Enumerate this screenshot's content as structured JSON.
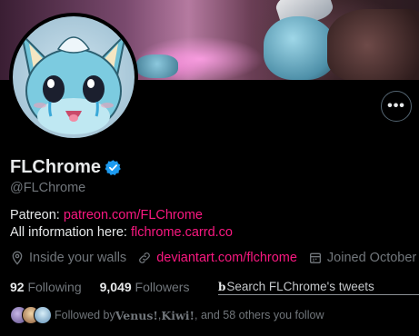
{
  "profile": {
    "display_name": "FLChrome",
    "handle": "@FLChrome",
    "verified_color": "#1d9bf0",
    "more_label": "•••"
  },
  "bio": {
    "line1_prefix": "Patreon: ",
    "line1_link": "patreon.com/FLChrome",
    "line2_prefix": "All information here: ",
    "line2_link": "flchrome.carrd.co"
  },
  "meta": {
    "location": "Inside your walls",
    "website": "deviantart.com/flchrome",
    "joined": "Joined October"
  },
  "stats": {
    "following_count": "92",
    "following_label": "Following",
    "followers_count": "9,049",
    "followers_label": "Followers"
  },
  "search": {
    "prefix": "b",
    "placeholder": "Search FLChrome's tweets"
  },
  "followed_by": {
    "prefix": "Followed by ",
    "name1": "Venus!",
    "sep1": ", ",
    "name2": "Kiwi!",
    "suffix": ", and 58 others you follow"
  },
  "colors": {
    "link": "#f91880",
    "muted": "#71767b",
    "text": "#e7e9ea",
    "background": "#000000"
  }
}
